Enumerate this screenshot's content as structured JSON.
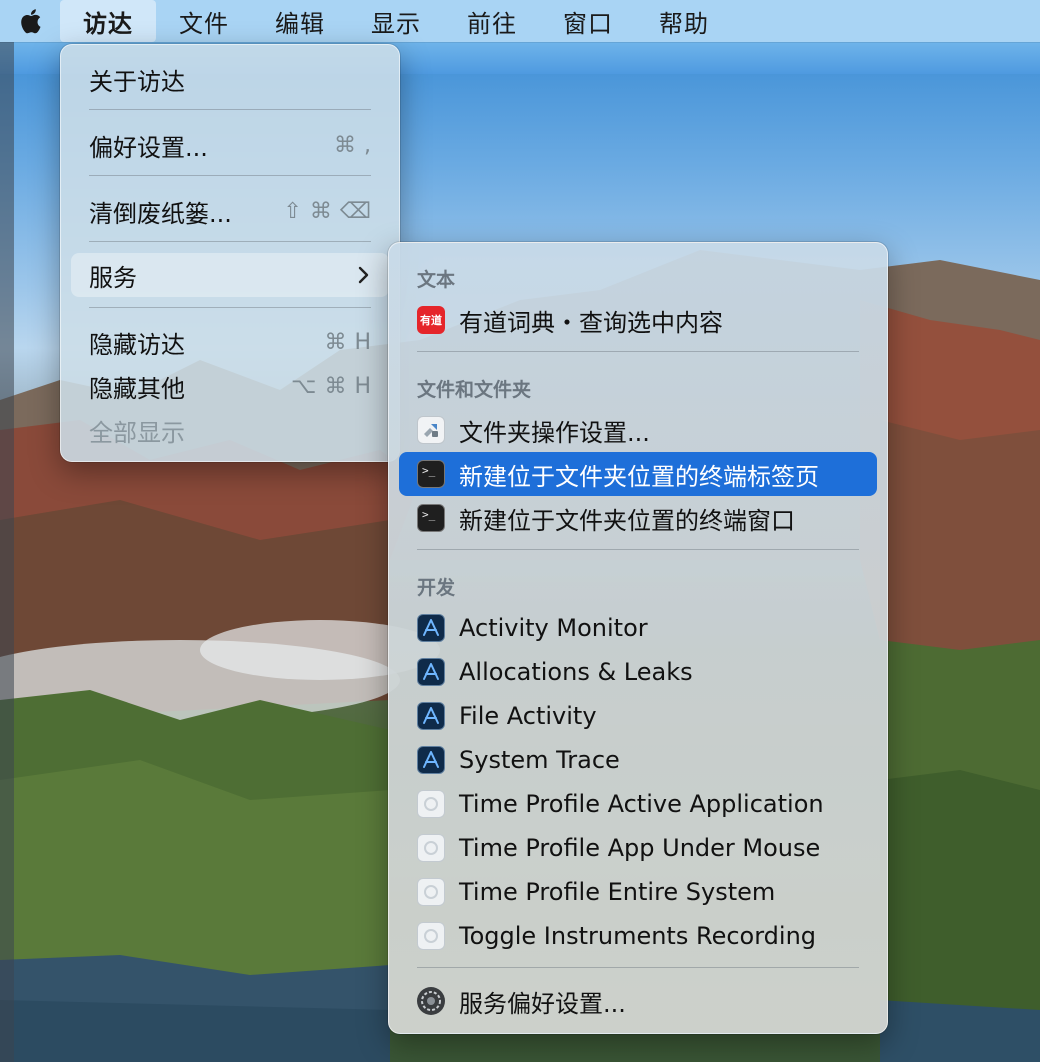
{
  "menubar": {
    "items": [
      "访达",
      "文件",
      "编辑",
      "显示",
      "前往",
      "窗口",
      "帮助"
    ],
    "active_index": 0
  },
  "finder_menu": {
    "about": "关于访达",
    "preferences": "偏好设置...",
    "preferences_shortcut": [
      "⌘",
      ","
    ],
    "empty_trash": "清倒废纸篓...",
    "empty_trash_shortcut": [
      "⇧",
      "⌘",
      "⌫"
    ],
    "services": "服务",
    "hide_finder": "隐藏访达",
    "hide_finder_shortcut": [
      "⌘",
      "H"
    ],
    "hide_others": "隐藏其他",
    "hide_others_shortcut": [
      "⌥",
      "⌘",
      "H"
    ],
    "show_all": "全部显示"
  },
  "services_menu": {
    "section_text": "文本",
    "youdao": "有道词典・查询选中内容",
    "youdao_icon_text": "有道",
    "section_files": "文件和文件夹",
    "folder_actions": "文件夹操作设置...",
    "new_terminal_tab": "新建位于文件夹位置的终端标签页",
    "new_terminal_window": "新建位于文件夹位置的终端窗口",
    "section_dev": "开发",
    "dev_items": [
      "Activity Monitor",
      "Allocations & Leaks",
      "File Activity",
      "System Trace",
      "Time Profile Active Application",
      "Time Profile App Under Mouse",
      "Time Profile Entire System",
      "Toggle Instruments Recording"
    ],
    "services_prefs": "服务偏好设置..."
  },
  "colors": {
    "menubar": "#a9d4f4",
    "selection": "#1e6fd9"
  }
}
